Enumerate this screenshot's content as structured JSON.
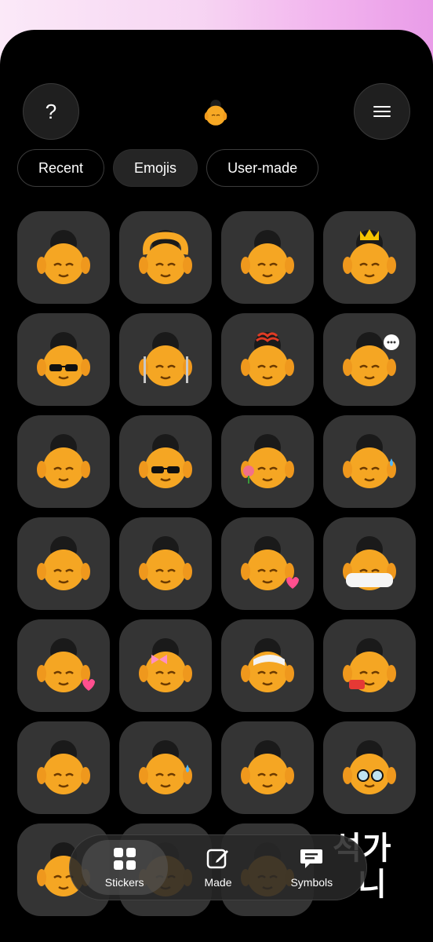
{
  "header": {
    "help_label": "?",
    "menu_icon": "hamburger-menu-icon",
    "logo_icon": "buddha-emoji-icon"
  },
  "tabs": [
    {
      "label": "Recent",
      "active": false
    },
    {
      "label": "Emojis",
      "active": true
    },
    {
      "label": "User-made",
      "active": false
    }
  ],
  "stickers": [
    {
      "name": "buddha-sticker-hand-gesture",
      "accessory": ""
    },
    {
      "name": "buddha-sticker-heart-hands-over-head",
      "accessory": "heart-arms"
    },
    {
      "name": "buddha-sticker-pleading-praying",
      "accessory": ""
    },
    {
      "name": "buddha-sticker-crown-shushing",
      "accessory": "crown"
    },
    {
      "name": "buddha-sticker-sunglasses-salute",
      "accessory": "sunglasses"
    },
    {
      "name": "buddha-sticker-fork-knife-tongue",
      "accessory": "fork-knife"
    },
    {
      "name": "buddha-sticker-hot-steam-pointing",
      "accessory": "steam"
    },
    {
      "name": "buddha-sticker-laughing-speech-bubble",
      "accessory": "speech-bubble"
    },
    {
      "name": "buddha-sticker-hands-over-mouth",
      "accessory": ""
    },
    {
      "name": "buddha-sticker-sunglasses-thinking",
      "accessory": "sunglasses"
    },
    {
      "name": "buddha-sticker-holding-tulip",
      "accessory": "flower"
    },
    {
      "name": "buddha-sticker-sweat-drop",
      "accessory": "sweat"
    },
    {
      "name": "buddha-sticker-teary-hands",
      "accessory": ""
    },
    {
      "name": "buddha-sticker-hands-on-head-smiling",
      "accessory": ""
    },
    {
      "name": "buddha-sticker-heart-hands-wink",
      "accessory": "heart"
    },
    {
      "name": "buddha-sticker-bathtub",
      "accessory": "bathtub"
    },
    {
      "name": "buddha-sticker-kissing-hearts",
      "accessory": "heart"
    },
    {
      "name": "buddha-sticker-bow-finger-lips",
      "accessory": "bow"
    },
    {
      "name": "buddha-sticker-bandaged-head",
      "accessory": "bandage"
    },
    {
      "name": "buddha-sticker-sos-crying",
      "accessory": "sos"
    },
    {
      "name": "buddha-sticker-content-smile",
      "accessory": ""
    },
    {
      "name": "buddha-sticker-hot-face-sweat",
      "accessory": "sweat"
    },
    {
      "name": "buddha-sticker-star-eyes-grin",
      "accessory": ""
    },
    {
      "name": "buddha-sticker-glasses-frown",
      "accessory": "glasses"
    },
    {
      "name": "buddha-sticker-teary-partial",
      "accessory": ""
    },
    {
      "name": "buddha-sticker-partial-two",
      "accessory": ""
    },
    {
      "name": "buddha-sticker-partial-three",
      "accessory": ""
    }
  ],
  "tabbar": [
    {
      "label": "Stickers",
      "icon": "grid-four-squares-icon",
      "active": true
    },
    {
      "label": "Made",
      "icon": "edit-square-pencil-icon",
      "active": false
    },
    {
      "label": "Symbols",
      "icon": "chat-bubble-lines-icon",
      "active": false
    }
  ],
  "watermark": {
    "line1": "석가",
    "line2": "니"
  },
  "colors": {
    "background": "#000000",
    "cell": "#343434",
    "accent_skin": "#f5a623",
    "hair": "#1a1a1a"
  }
}
